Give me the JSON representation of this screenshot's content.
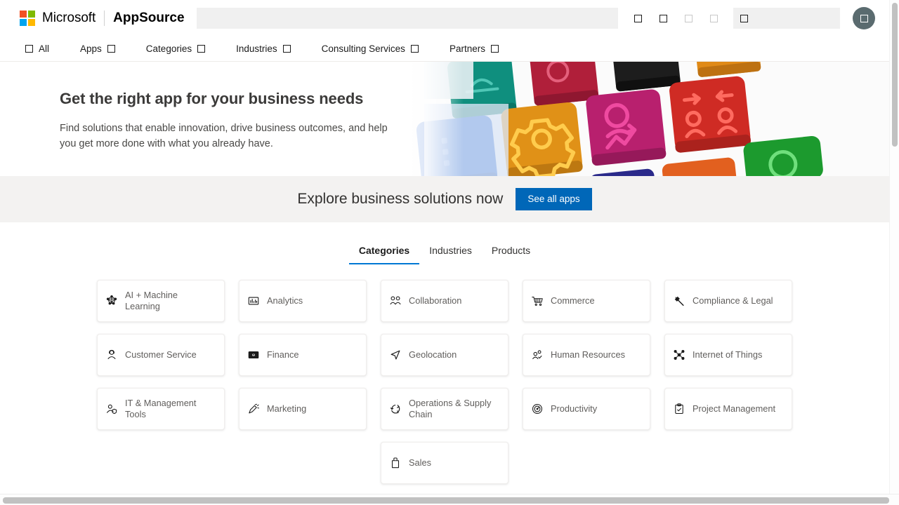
{
  "header": {
    "brand_microsoft": "Microsoft",
    "brand_product": "AppSource",
    "search_placeholder": "",
    "search_value": "",
    "signin_label": "",
    "icons": [
      "glyph-box-icon",
      "glyph-box-icon",
      "glyph-box-icon",
      "glyph-box-icon"
    ],
    "avatar_icon": "glyph-box-icon"
  },
  "nav": {
    "items": [
      {
        "label": "All",
        "icon": "glyph-box-icon",
        "icon_leading": true,
        "has_chevron": false
      },
      {
        "label": "Apps",
        "icon": "glyph-box-icon",
        "icon_leading": false,
        "has_chevron": true
      },
      {
        "label": "Categories",
        "icon": "glyph-box-icon",
        "icon_leading": false,
        "has_chevron": true
      },
      {
        "label": "Industries",
        "icon": "glyph-box-icon",
        "icon_leading": false,
        "has_chevron": true
      },
      {
        "label": "Consulting Services",
        "icon": "glyph-box-icon",
        "icon_leading": false,
        "has_chevron": true
      },
      {
        "label": "Partners",
        "icon": "glyph-box-icon",
        "icon_leading": false,
        "has_chevron": true
      }
    ]
  },
  "hero": {
    "title": "Get the right app for your business needs",
    "subtitle": "Find solutions that enable innovation, drive business outcomes, and help you get more done with what you already have."
  },
  "explore": {
    "title": "Explore business solutions now",
    "button_label": "See all apps",
    "button_color": "#0067b8"
  },
  "tabs": {
    "items": [
      {
        "label": "Categories",
        "active": true
      },
      {
        "label": "Industries",
        "active": false
      },
      {
        "label": "Products",
        "active": false
      }
    ],
    "active_underline_color": "#0078d4"
  },
  "categories": {
    "cards": [
      {
        "label": "AI + Machine Learning",
        "icon": "ai-machine-learning-icon"
      },
      {
        "label": "Analytics",
        "icon": "analytics-icon"
      },
      {
        "label": "Collaboration",
        "icon": "collaboration-icon"
      },
      {
        "label": "Commerce",
        "icon": "commerce-cart-icon"
      },
      {
        "label": "Compliance & Legal",
        "icon": "gavel-icon"
      },
      {
        "label": "Customer Service",
        "icon": "headset-person-icon"
      },
      {
        "label": "Finance",
        "icon": "banknote-icon"
      },
      {
        "label": "Geolocation",
        "icon": "navigation-arrow-icon"
      },
      {
        "label": "Human Resources",
        "icon": "people-check-icon"
      },
      {
        "label": "Internet of Things",
        "icon": "iot-nodes-icon"
      },
      {
        "label": "IT & Management Tools",
        "icon": "person-shield-icon"
      },
      {
        "label": "Marketing",
        "icon": "megaphone-icon"
      },
      {
        "label": "Operations & Supply Chain",
        "icon": "circular-arrows-icon"
      },
      {
        "label": "Productivity",
        "icon": "gauge-icon"
      },
      {
        "label": "Project Management",
        "icon": "clipboard-check-icon"
      },
      {
        "label": "Sales",
        "icon": "shopping-bag-icon"
      }
    ]
  },
  "scrollbars": {
    "vertical_thumb_color": "#c1c1c1",
    "horizontal_thumb_color": "#c1c1c1"
  }
}
